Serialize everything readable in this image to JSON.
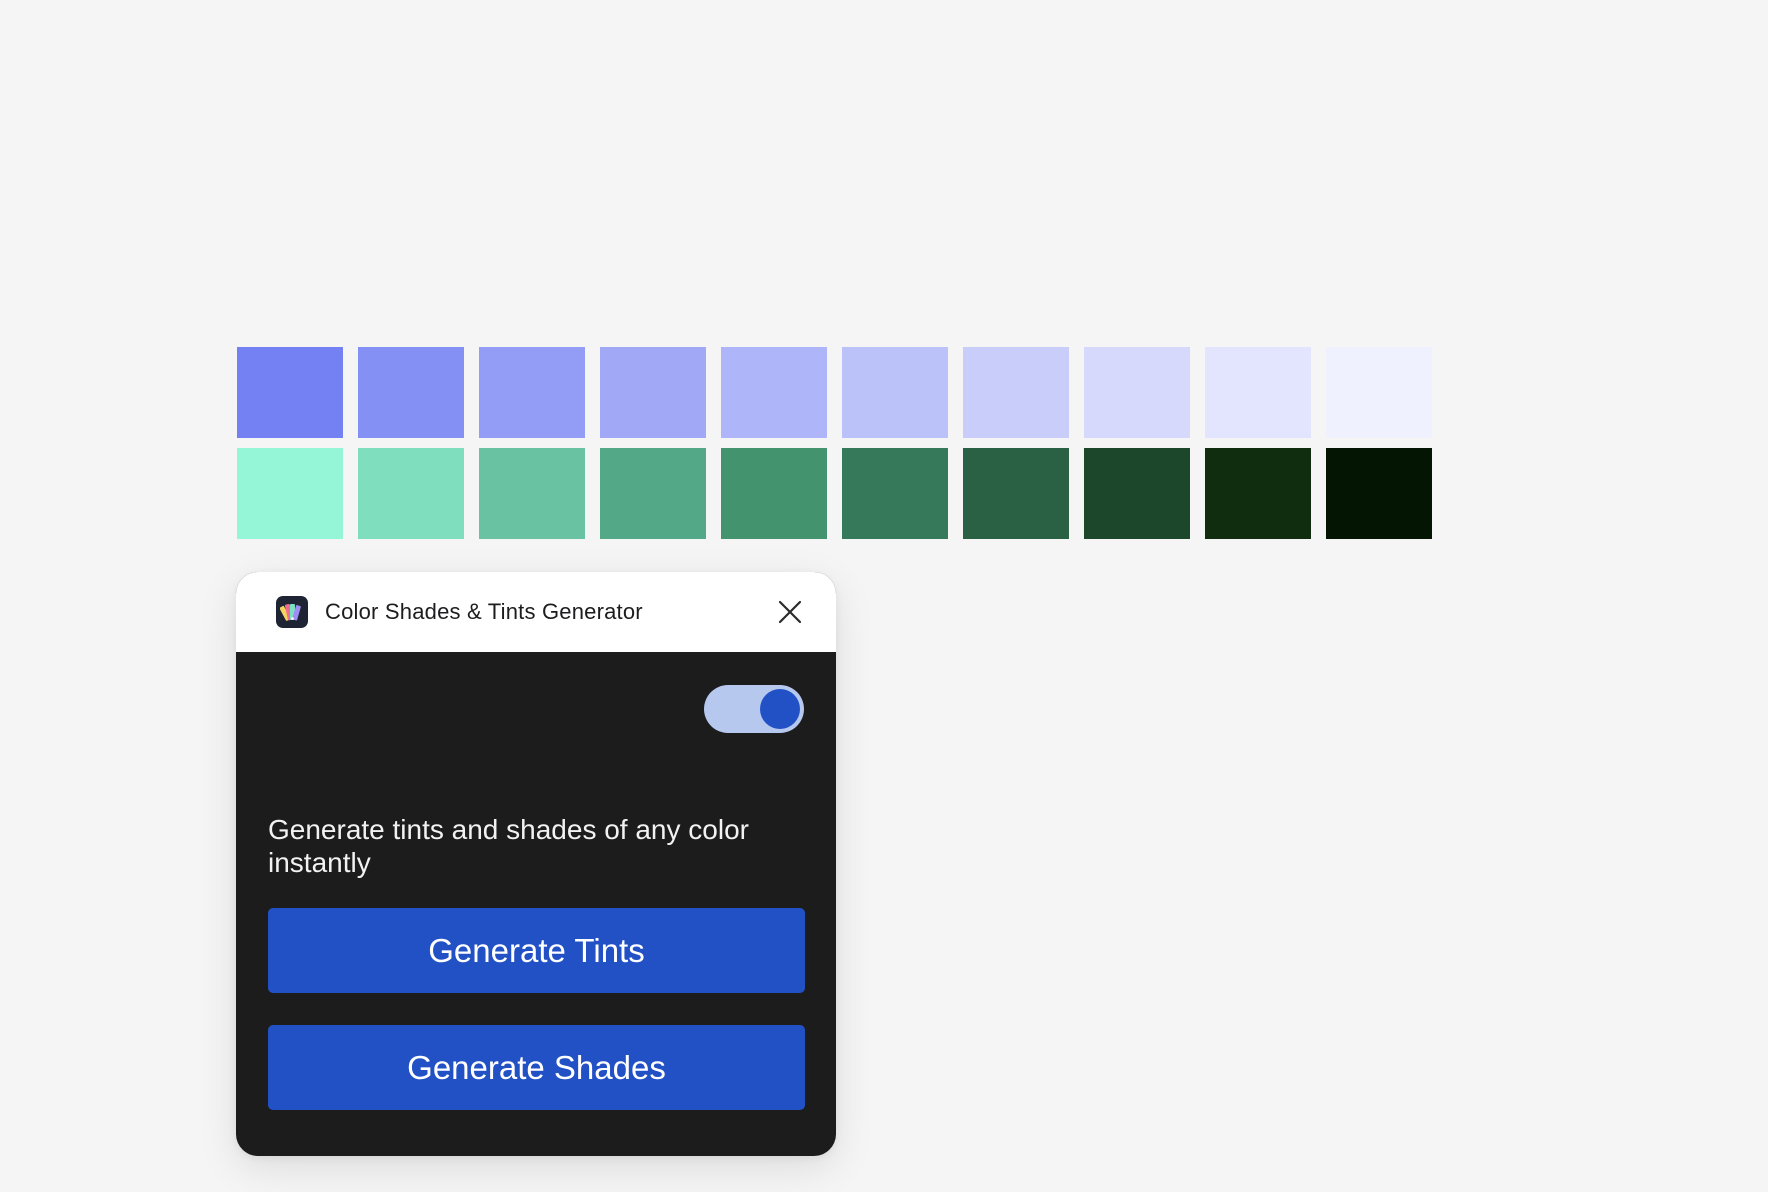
{
  "swatches": {
    "tints": [
      "#7481f3",
      "#8590f5",
      "#939df6",
      "#a1a9f7",
      "#aeb5f8",
      "#bbc1f9",
      "#c9cdfa",
      "#d6d9fb",
      "#e2e5fd",
      "#f0f1fe"
    ],
    "shades": [
      "#95f5d7",
      "#7fdebe",
      "#69c3a3",
      "#53a888",
      "#44936f",
      "#35785a",
      "#2a6043",
      "#1d472a",
      "#102d10",
      "#041603"
    ]
  },
  "popup": {
    "title": "Color Shades & Tints Generator",
    "app_icon": "color-palette-fan-icon",
    "close_icon": "close-icon",
    "toggle_on": true,
    "description": "Generate tints and shades of any color instantly",
    "buttons": {
      "tints": "Generate Tints",
      "shades": "Generate Shades"
    },
    "accent_color": "#2251c6",
    "body_color": "#1c1c1d"
  }
}
